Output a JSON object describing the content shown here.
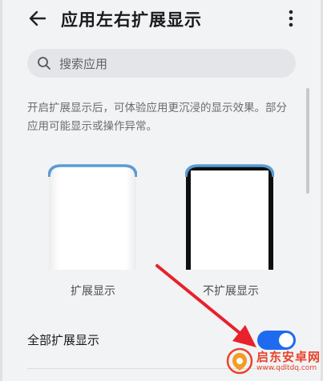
{
  "header": {
    "title": "应用左右扩展显示"
  },
  "search": {
    "placeholder": "搜索应用"
  },
  "description": "开启扩展显示后，可体验应用更沉浸的显示效果。部分应用可能显示或操作异常。",
  "previews": [
    {
      "caption": "扩展显示"
    },
    {
      "caption": "不扩展显示"
    }
  ],
  "setting": {
    "label": "全部扩展显示",
    "enabled": true
  },
  "watermark": {
    "name": "启东安卓网",
    "url": "www.qdltdq.com"
  },
  "colors": {
    "accent": "#1f6bf0",
    "annotation": "#e8212a",
    "preview_top": "#5b9bd5"
  }
}
